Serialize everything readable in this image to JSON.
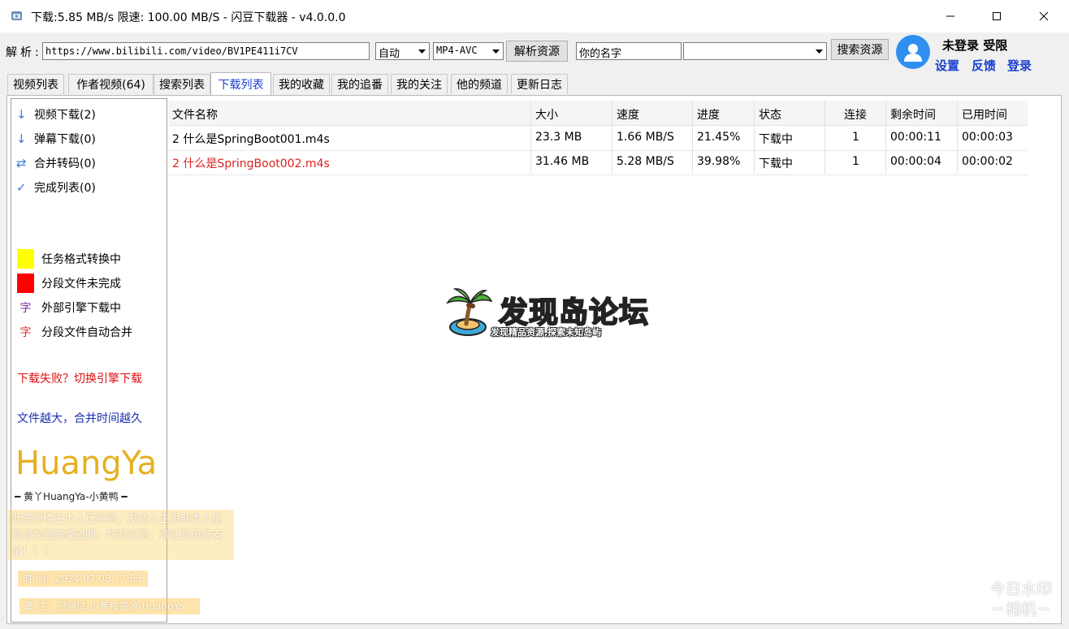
{
  "window": {
    "title": "下载:5.85 MB/s  限速: 100.00 MB/S  - 闪豆下载器 - v4.0.0.0"
  },
  "toolbar": {
    "parse_label": "解析:",
    "url_value": "https://www.bilibili.com/video/BV1PE411i7CV",
    "quality_value": "自动",
    "format_value": "MP4-AVC",
    "parse_button": "解析资源",
    "name_value": "你的名字",
    "search_combo_value": "",
    "search_button": "搜索资源"
  },
  "user": {
    "status": "未登录  受限",
    "settings_link": "设置",
    "feedback_link": "反馈",
    "login_link": "登录"
  },
  "tabs": [
    {
      "label": "视频列表",
      "active": false
    },
    {
      "label": "作者视频(64)",
      "active": false
    },
    {
      "label": "搜索列表",
      "active": false
    },
    {
      "label": "下载列表",
      "active": true
    },
    {
      "label": "我的收藏",
      "active": false
    },
    {
      "label": "我的追番",
      "active": false
    },
    {
      "label": "我的关注",
      "active": false
    },
    {
      "label": "他的频道",
      "active": false
    },
    {
      "label": "更新日志",
      "active": false
    }
  ],
  "sidebar": {
    "items": [
      {
        "icon": "arrow-down-icon",
        "label": "视频下载(2)"
      },
      {
        "icon": "arrow-down-icon",
        "label": "弹幕下载(0)"
      },
      {
        "icon": "swap-icon",
        "label": "合并转码(0)"
      },
      {
        "icon": "check-icon",
        "label": "完成列表(0)"
      }
    ],
    "legend": [
      {
        "kind": "swatch",
        "color": "#ffff00",
        "label": "任务格式转换中"
      },
      {
        "kind": "swatch",
        "color": "#ff0000",
        "label": "分段文件未完成"
      },
      {
        "kind": "glyph",
        "glyph": "字",
        "color": "#7b2fb0",
        "label": "外部引擎下载中"
      },
      {
        "kind": "glyph",
        "glyph": "字",
        "color": "#e03030",
        "label": "分段文件自动合并"
      }
    ],
    "note_red": "下载失败？切换引擎下载",
    "note_blue": "文件越大，合并时间越久"
  },
  "table": {
    "columns": [
      "文件名称",
      "大小",
      "速度",
      "进度",
      "状态",
      "连接",
      "剩余时间",
      "已用时间"
    ],
    "rows": [
      {
        "name": "2 什么是SpringBoot001.m4s",
        "size": "23.3 MB",
        "speed": "1.66 MB/S",
        "progress": "21.45%",
        "status": "下载中",
        "connections": "1",
        "remaining": "00:00:11",
        "elapsed": "00:00:03",
        "color": "#000000"
      },
      {
        "name": "2 什么是SpringBoot002.m4s",
        "size": "31.46 MB",
        "speed": "5.28 MB/S",
        "progress": "39.98%",
        "status": "下载中",
        "connections": "1",
        "remaining": "00:00:04",
        "elapsed": "00:00:02",
        "color": "#e02020"
      }
    ]
  },
  "watermarks": {
    "forum_title": "发现岛论坛",
    "forum_subtitle": "发现精品资源,探索未知岛屿",
    "brand": "HuangYa",
    "brand_sub": "━ 黄丫HuangYa-小黄鸭 ━",
    "stamp_text": "此资源楼主本人已亲测，发帖人主页非本人信息皆为盗贴或盗图，均非实测，请注意设备安全！！！",
    "stamp_time": "时  间：2024.07.08 17:53",
    "stamp_note": "备  注：已测试-小黄鸭资源-HuangYa",
    "camera_line1": "今日水印",
    "camera_line2": "－相机－"
  }
}
